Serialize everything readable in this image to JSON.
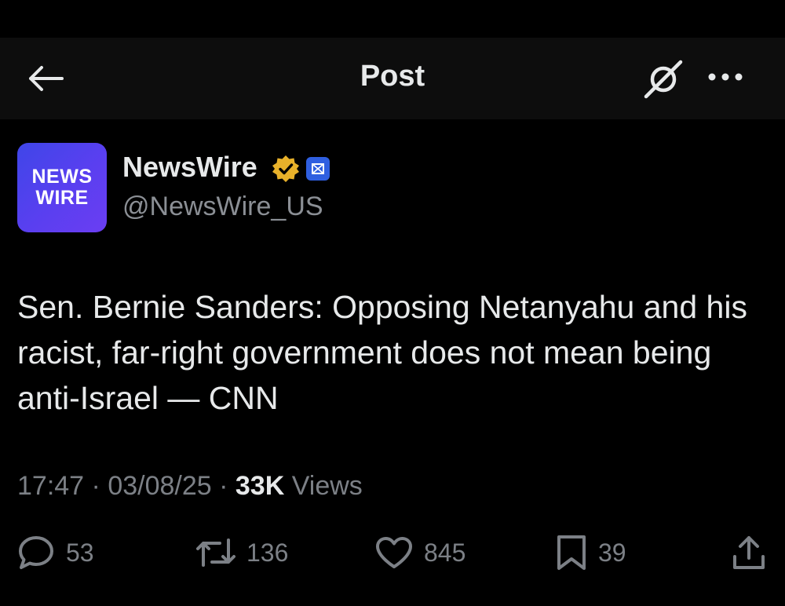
{
  "header": {
    "title": "Post",
    "back_icon": "arrow-left-icon",
    "grok_icon": "grok-icon",
    "more_icon": "more-horizontal-icon"
  },
  "author": {
    "avatar_line1": "NEWS",
    "avatar_line2": "WIRE",
    "display_name": "NewsWire",
    "handle": "@NewsWire_US",
    "verified_badge": "gold-check-badge-icon",
    "affiliate_badge": "affiliate-badge-icon"
  },
  "post": {
    "text": "Sen. Bernie Sanders: Opposing Netanyahu and his racist, far-right government does not mean being anti-Israel — CNN"
  },
  "meta": {
    "time": "17:47",
    "separator1": " · ",
    "date": "03/08/25",
    "separator2": " · ",
    "views_count": "33K",
    "views_label": " Views"
  },
  "actions": {
    "replies": "53",
    "reposts": "136",
    "likes": "845",
    "bookmarks": "39"
  },
  "colors": {
    "background": "#000000",
    "text": "#e7e9ea",
    "muted": "#7c8086",
    "verified_gold": "#e8b12a",
    "affiliate_blue": "#2f5fe0"
  }
}
